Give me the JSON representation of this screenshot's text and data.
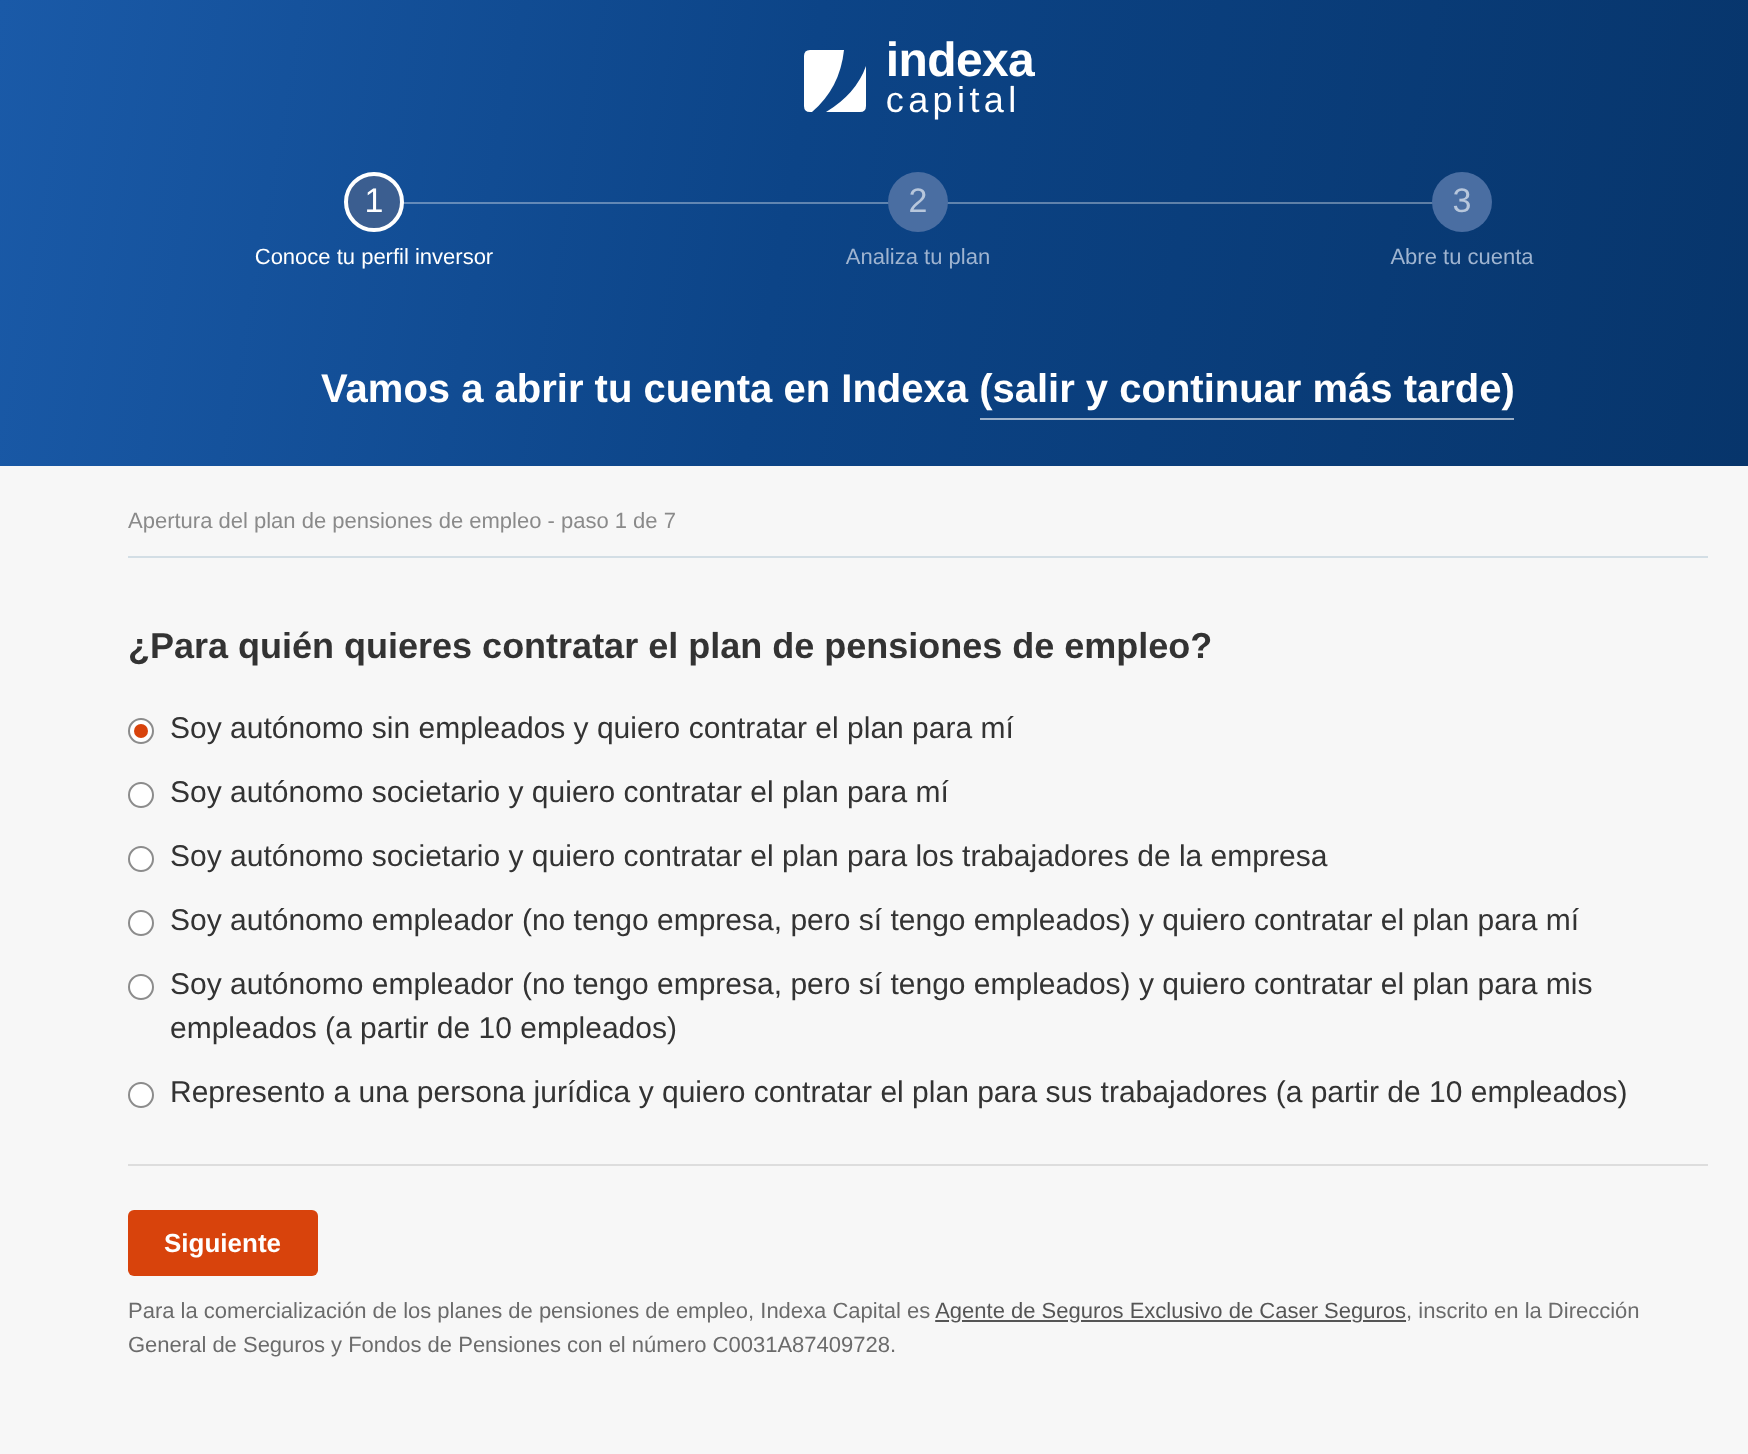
{
  "header": {
    "logo": {
      "name": "indexa",
      "subname": "capital"
    },
    "steps": [
      {
        "number": "1",
        "label": "Conoce tu perfil inversor",
        "selected": true
      },
      {
        "number": "2",
        "label": "Analiza tu plan",
        "selected": false
      },
      {
        "number": "3",
        "label": "Abre tu cuenta",
        "selected": false
      }
    ],
    "title": "Vamos a abrir tu cuenta en Indexa",
    "exit_link": "(salir y continuar más tarde)"
  },
  "form": {
    "breadcrumb": "Apertura del plan de pensiones de empleo - paso 1 de 7",
    "question": "¿Para quién quieres contratar el plan de pensiones de empleo?",
    "options": [
      {
        "label": "Soy autónomo sin empleados y quiero contratar el plan para mí",
        "selected": true
      },
      {
        "label": "Soy autónomo societario y quiero contratar el plan para mí",
        "selected": false
      },
      {
        "label": "Soy autónomo societario y quiero contratar el plan para los trabajadores de la empresa",
        "selected": false
      },
      {
        "label": "Soy autónomo empleador (no tengo empresa, pero sí tengo empleados) y quiero contratar el plan para mí",
        "selected": false
      },
      {
        "label": "Soy autónomo empleador (no tengo empresa, pero sí tengo empleados) y quiero contratar el plan para mis empleados (a partir de 10 empleados)",
        "selected": false
      },
      {
        "label": "Represento a una persona jurídica y quiero contratar el plan para sus trabajadores (a partir de 10 empleados)",
        "selected": false
      }
    ],
    "button": "Siguiente",
    "disclaimer": {
      "before": "Para la comercialización de los planes de pensiones de empleo, Indexa Capital es ",
      "link": "Agente de Seguros Exclusivo de Caser Seguros",
      "after": ", inscrito en la Dirección General de Seguros y Fondos de Pensiones con el número C0031A87409728."
    }
  }
}
